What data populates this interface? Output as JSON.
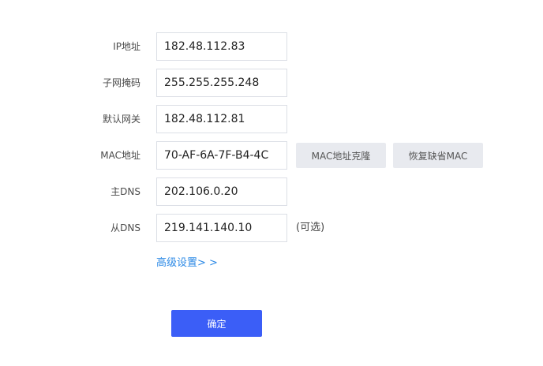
{
  "form": {
    "ip": {
      "label": "IP地址",
      "value": "182.48.112.83"
    },
    "mask": {
      "label": "子网掩码",
      "value": "255.255.255.248"
    },
    "gateway": {
      "label": "默认网关",
      "value": "182.48.112.81"
    },
    "mac": {
      "label": "MAC地址",
      "value": "70-AF-6A-7F-B4-4C",
      "clone_label": "MAC地址克隆",
      "restore_label": "恢复缺省MAC"
    },
    "dns1": {
      "label": "主DNS",
      "value": "202.106.0.20"
    },
    "dns2": {
      "label": "从DNS",
      "value": "219.141.140.10",
      "hint": "(可选)"
    }
  },
  "advanced_label": "高级设置> >",
  "confirm_label": "确定"
}
